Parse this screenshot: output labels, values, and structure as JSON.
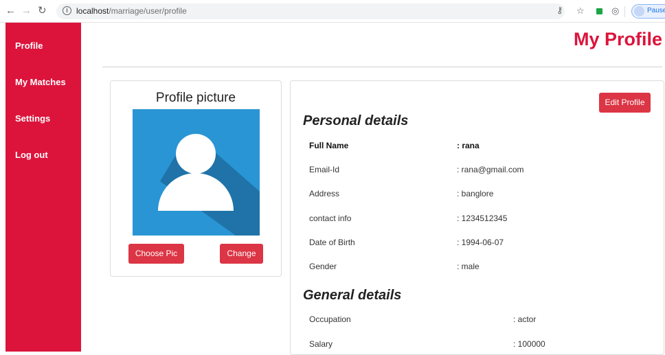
{
  "browser": {
    "url_host": "localhost",
    "url_path": "/marriage/user/profile",
    "profile_label": "Paused"
  },
  "sidebar": {
    "items": [
      {
        "label": "Profile"
      },
      {
        "label": "My Matches"
      },
      {
        "label": "Settings"
      },
      {
        "label": "Log out"
      }
    ]
  },
  "header": {
    "title": "My Profile"
  },
  "picture_card": {
    "title": "Profile picture",
    "choose_label": "Choose Pic",
    "change_label": "Change"
  },
  "details": {
    "edit_label": "Edit Profile",
    "personal_heading": "Personal details",
    "personal": [
      {
        "label": "Full Name",
        "value": ": rana"
      },
      {
        "label": "Email-Id",
        "value": ": rana@gmail.com"
      },
      {
        "label": "Address",
        "value": ": banglore"
      },
      {
        "label": "contact info",
        "value": ": 1234512345"
      },
      {
        "label": "Date of Birth",
        "value": ": 1994-06-07"
      },
      {
        "label": "Gender",
        "value": ": male"
      }
    ],
    "general_heading": "General details",
    "general": [
      {
        "label": "Occupation",
        "value": ": actor"
      },
      {
        "label": "Salary",
        "value": ": 100000"
      }
    ]
  },
  "colors": {
    "brand": "#dc143c",
    "button": "#dc3545",
    "avatar_bg": "#2a95d4"
  }
}
